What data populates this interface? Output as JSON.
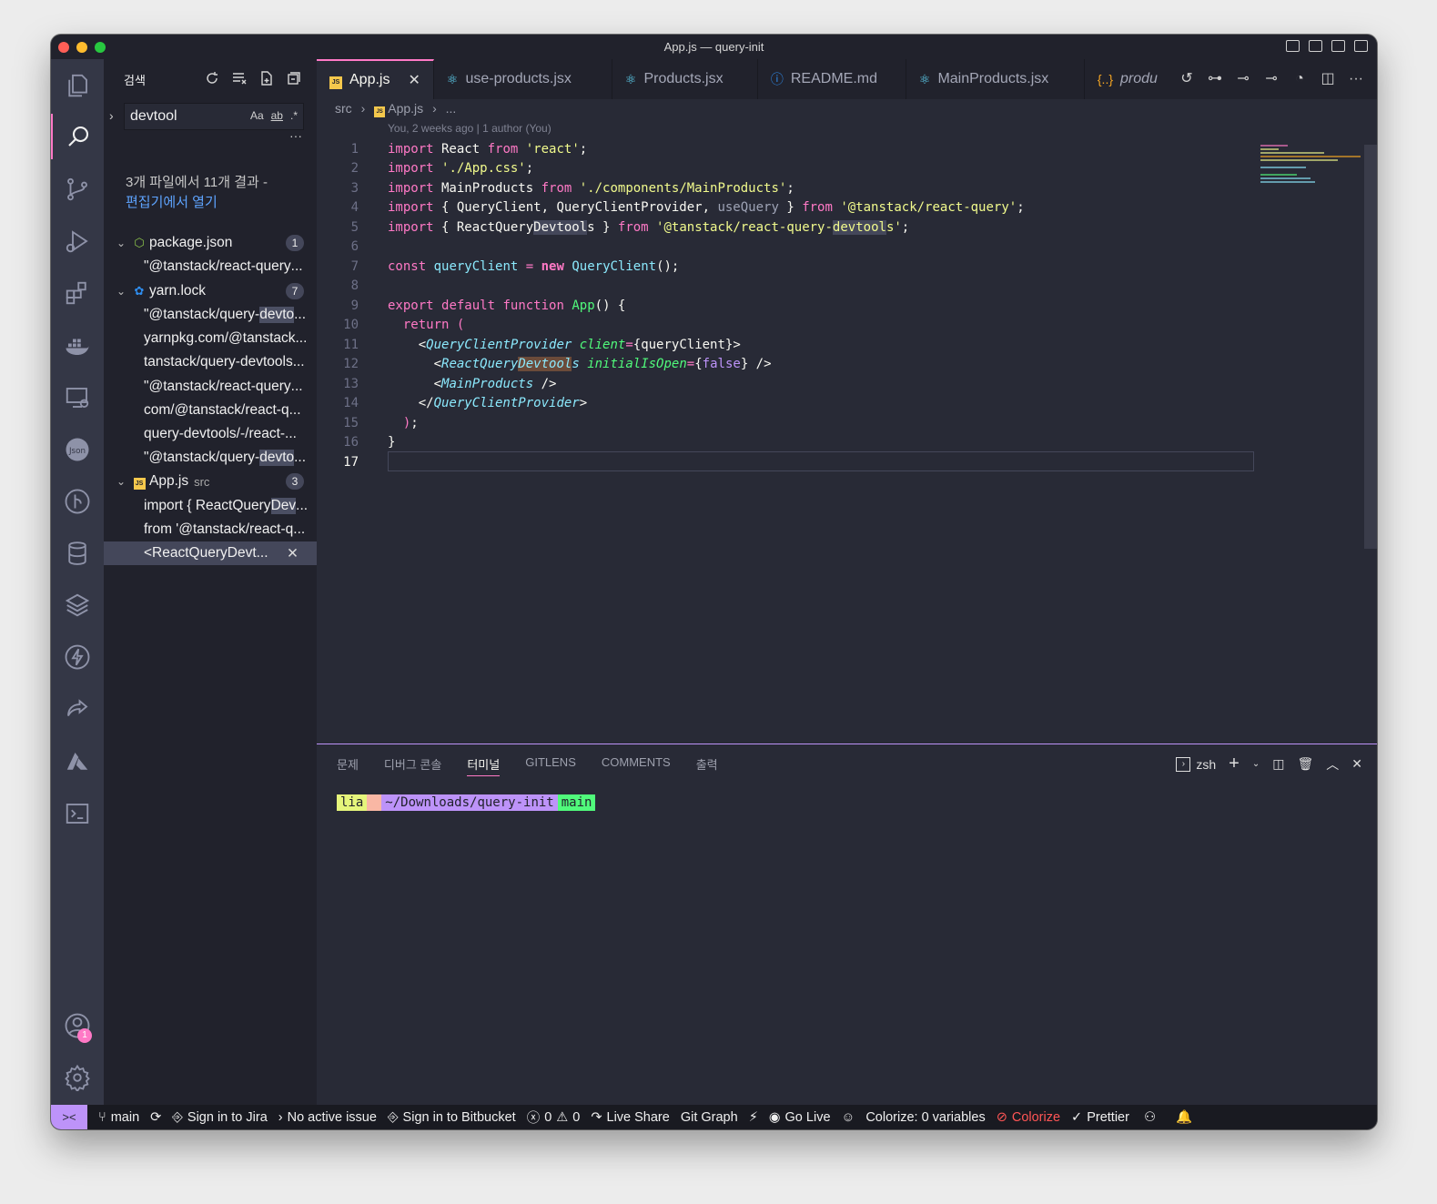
{
  "window": {
    "title": "App.js — query-init"
  },
  "sidebar": {
    "title": "검색",
    "search": {
      "value": "devtool",
      "opt_case": "Aa",
      "opt_word": "ab",
      "opt_regex": ".*"
    },
    "results_message": "3개 파일에서 11개 결과 -",
    "open_in_editor": "편집기에서 열기",
    "files": [
      {
        "name": "package.json",
        "path": "",
        "count": "1",
        "matches": [
          {
            "pre": "\"@tanstack/react-query",
            "hl": "",
            "post": "..."
          }
        ]
      },
      {
        "name": "yarn.lock",
        "path": "",
        "count": "7",
        "matches": [
          {
            "pre": "\"@tanstack/query-",
            "hl": "devto",
            "post": "..."
          },
          {
            "pre": "yarnpkg.com/@tanstack...",
            "hl": "",
            "post": ""
          },
          {
            "pre": "tanstack/query-devtools...",
            "hl": "",
            "post": ""
          },
          {
            "pre": "\"@tanstack/react-query",
            "hl": "",
            "post": "..."
          },
          {
            "pre": "com/@tanstack/react-q...",
            "hl": "",
            "post": ""
          },
          {
            "pre": "query-devtools/-/react-...",
            "hl": "",
            "post": ""
          },
          {
            "pre": "\"@tanstack/query-",
            "hl": "devto",
            "post": "..."
          }
        ]
      },
      {
        "name": "App.js",
        "path": "src",
        "count": "3",
        "matches": [
          {
            "pre": "import { ReactQuery",
            "hl": "Dev",
            "post": "..."
          },
          {
            "pre": "from '@tanstack/react-q...",
            "hl": "",
            "post": ""
          },
          {
            "pre": "<ReactQueryDevt...",
            "hl": "",
            "post": ""
          }
        ]
      }
    ]
  },
  "tabs": [
    {
      "label": "App.js",
      "icon": "JS",
      "active": true
    },
    {
      "label": "use-products.jsx",
      "icon": "react-icon"
    },
    {
      "label": "Products.jsx",
      "icon": "react-icon"
    },
    {
      "label": "README.md",
      "icon": "info-icon"
    },
    {
      "label": "MainProducts.jsx",
      "icon": "react-icon"
    },
    {
      "label": "produ",
      "icon": "braces-icon"
    }
  ],
  "breadcrumb": {
    "folder": "src",
    "file": "App.js",
    "more": "..."
  },
  "blame": "You, 2 weeks ago | 1 author (You)",
  "code_lines": [
    "1",
    "2",
    "3",
    "4",
    "5",
    "6",
    "7",
    "8",
    "9",
    "10",
    "11",
    "12",
    "13",
    "14",
    "15",
    "16",
    "17"
  ],
  "panel": {
    "tabs": [
      "문제",
      "디버그 콘솔",
      "터미널",
      "GITLENS",
      "COMMENTS",
      "출력"
    ],
    "active_tab": "터미널",
    "shell": "zsh",
    "prompt": {
      "user": "lia",
      "path": "~/Downloads/query-init",
      "branch": "main"
    }
  },
  "status": {
    "branch": "main",
    "jira": "Sign in to Jira",
    "issue": "No active issue",
    "bitbucket": "Sign in to Bitbucket",
    "errors": "0",
    "warnings": "0",
    "live_share": "Live Share",
    "git_graph": "Git Graph",
    "go_live": "Go Live",
    "colorize_vars": "Colorize: 0 variables",
    "colorize": "Colorize",
    "prettier": "Prettier"
  },
  "accounts_badge": "1",
  "colors": {
    "accent": "#ff79c6",
    "purple": "#bd93f9",
    "bg": "#282a36",
    "sidebar": "#21222c"
  }
}
